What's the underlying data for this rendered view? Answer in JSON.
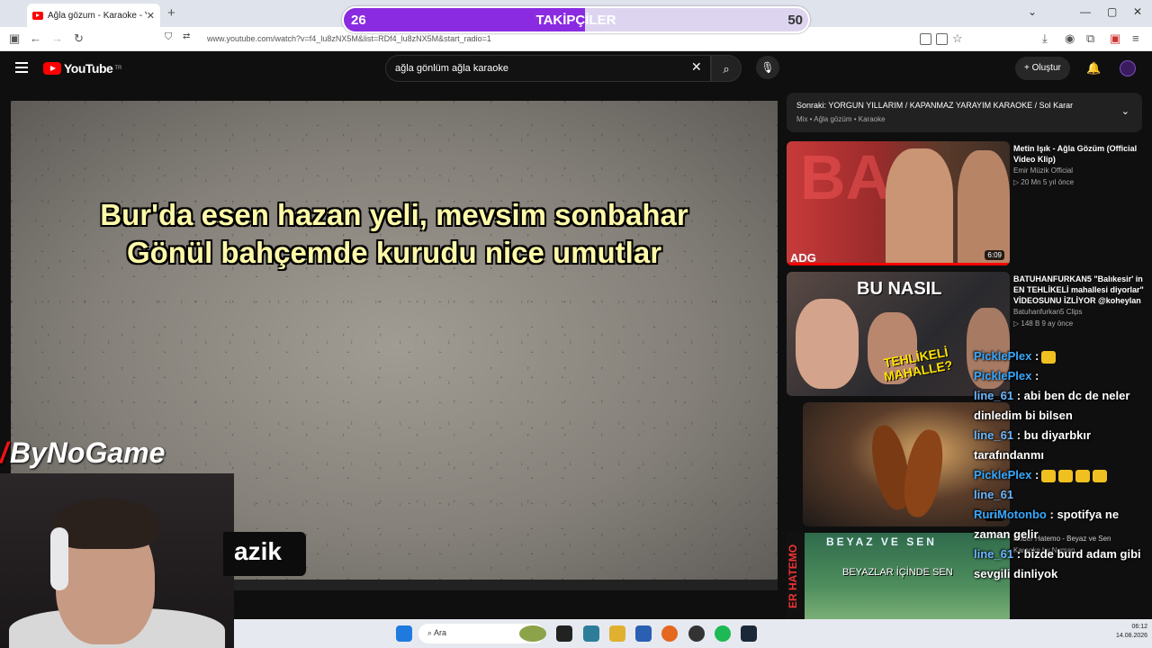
{
  "browser": {
    "tab_title": "Ağla gözum - Karaoke - Yo",
    "url": "www.youtube.com/watch?v=f4_lu8zNX5M&list=RDf4_lu8zNX5M&start_radio=1"
  },
  "follower_goal": {
    "current": "26",
    "label": "TAKİPÇİLER",
    "target": "50",
    "progress": 0.52
  },
  "youtube": {
    "logo": "YouTube",
    "country": "TR",
    "search_value": "ağla gönlüm ağla karaoke",
    "create_label": "Oluştur"
  },
  "video": {
    "lyric_line_1": "Bur'da esen hazan yeli, mevsim sonbahar",
    "lyric_line_2": "Gönül bahçemde kurudu nice umutlar"
  },
  "up_next": {
    "title": "Sonraki: YORGUN YILLARIM / KAPANMAZ YARAYIM KARAOKE / Sol Karar",
    "subtitle": "Mix • Ağla gözüm • Karaoke"
  },
  "recommendations": [
    {
      "title": "Metin Işık - Ağla Gözüm (Official Video Klip)",
      "channel": "Emir Müzik Official",
      "meta": "▷ 20 Mn   5 yıl önce",
      "duration": "6:09",
      "thumb_text": "ADG"
    },
    {
      "title": "BATUHANFURKAN5 \"Balıkesir' in EN TEHLİKELİ mahallesi diyorlar\" VİDEOSUNU İZLİYOR @koheylan",
      "channel": "Batuhanfurkan5 Clips",
      "meta": "▷ 148 B   9 ay önce",
      "thumb_text_1": "BU NASIL",
      "thumb_text_2": "TEHLİKELİ MAHALLE?"
    },
    {
      "title": "",
      "channel": "",
      "meta": "",
      "duration": "4:47"
    },
    {
      "title": "Rober Hatemo - Beyaz ve Sen",
      "channel": "Karaoke by Numan",
      "thumb_text_1": "BEYAZ VE SEN",
      "thumb_text_2": "BEYAZLAR İÇİNDE SEN",
      "thumb_side": "ER HATEMO"
    }
  ],
  "overlay": {
    "brand": "ByNoGame",
    "lower_tag": "azik"
  },
  "chat": [
    {
      "user": "PicklePlex",
      "text": ":",
      "emotes": 1
    },
    {
      "user": "PicklePlex",
      "text": ":",
      "emotes": 0
    },
    {
      "user": "line_61",
      "text": ": abi ben dc de neler dinledim bi bilsen",
      "emotes": 0
    },
    {
      "user": "line_61",
      "text": ": bu diyarbkır tarafındanmı",
      "emotes": 0
    },
    {
      "user": "PicklePlex",
      "text": ":",
      "emotes": 4
    },
    {
      "user": "line_61",
      "text": "",
      "emotes": 0
    },
    {
      "user": "RuriMotonbo",
      "text": ": spotifya ne zaman gelir",
      "emotes": 0
    },
    {
      "user": "line_61",
      "text": ": bizde burd adam gibi sevgili dinliyok",
      "emotes": 0
    }
  ],
  "taskbar": {
    "search_label": "Ara",
    "time": "06:12",
    "date": "14.08.2026"
  },
  "colors": {
    "accent": "#8a2be2",
    "youtube_red": "#ff0000",
    "lyric": "#fff9a8"
  }
}
